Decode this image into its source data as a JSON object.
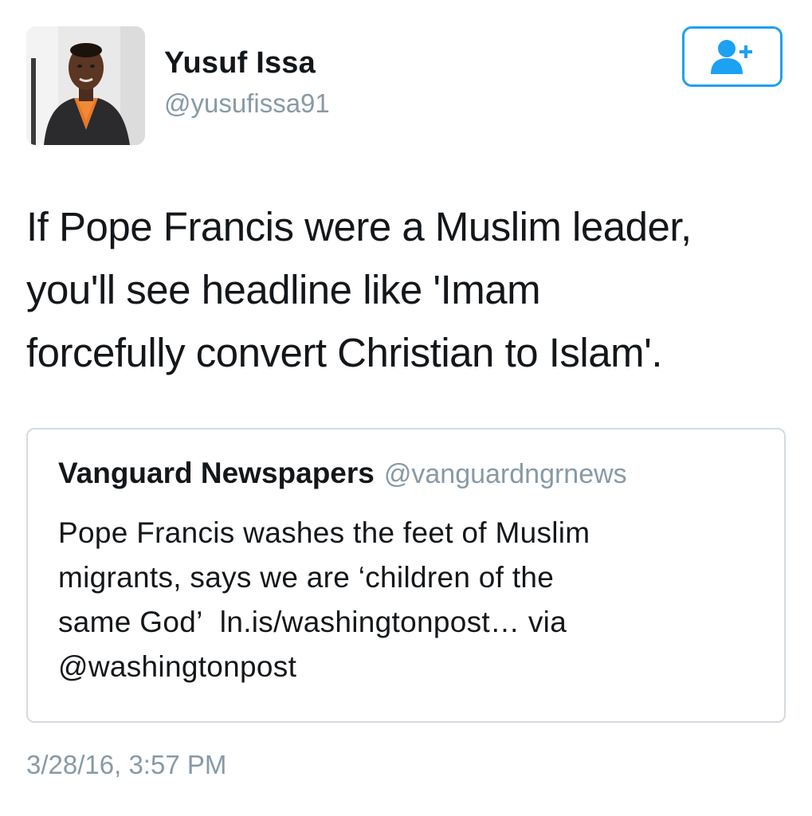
{
  "author": {
    "display_name": "Yusuf Issa",
    "handle": "@yusufissa91",
    "avatar_icon": "profile-photo"
  },
  "follow_button": {
    "icon": "follow-person-plus-icon",
    "color": "#1da1f2"
  },
  "tweet": {
    "lines": [
      "If Pope Francis were a Muslim leader,",
      "you'll see headline like 'Imam",
      "forcefully convert Christian to Islam'."
    ]
  },
  "quoted_tweet": {
    "display_name": "Vanguard Newspapers",
    "handle": "@vanguardngrnews",
    "lines": [
      "Pope Francis washes the feet of Muslim",
      "migrants, says we are ‘children of the",
      "same God’",
      "ln.is/washingtonpost…",
      " via",
      "@washingtonpost"
    ]
  },
  "timestamp": "3/28/16, 3:57 PM",
  "colors": {
    "text": "#14171a",
    "secondary_text": "#8899a6",
    "accent": "#1da1f2",
    "border": "#d4dbe1"
  }
}
